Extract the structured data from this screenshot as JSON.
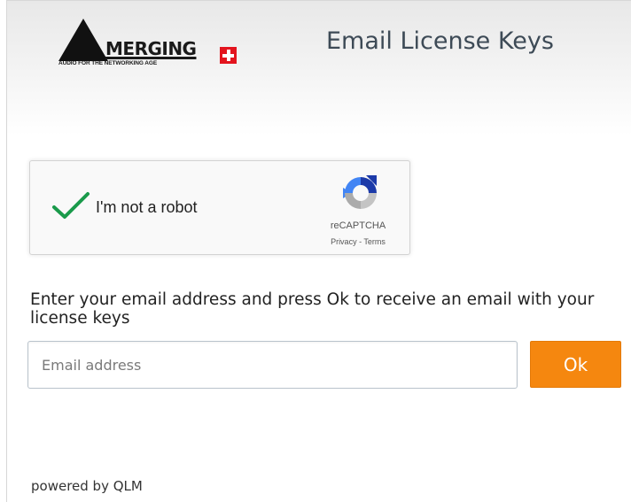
{
  "header": {
    "logo_word": "MERGING",
    "logo_tagline": "AUDIO FOR THE NETWORKING AGE",
    "title": "Email License Keys"
  },
  "recaptcha": {
    "checked": true,
    "label": "I'm not a robot",
    "brand": "reCAPTCHA",
    "privacy_link": "Privacy",
    "separator": " - ",
    "terms_link": "Terms",
    "check_color": "#1a9a4b",
    "icon": "recaptcha-logo-icon"
  },
  "form": {
    "instructions": "Enter your email address and press Ok to receive an email with your license keys",
    "email_placeholder": "Email address",
    "email_value": "",
    "ok_label": "Ok",
    "accent_color": "#f5870f"
  },
  "footer": {
    "powered_by": "powered by QLM"
  }
}
